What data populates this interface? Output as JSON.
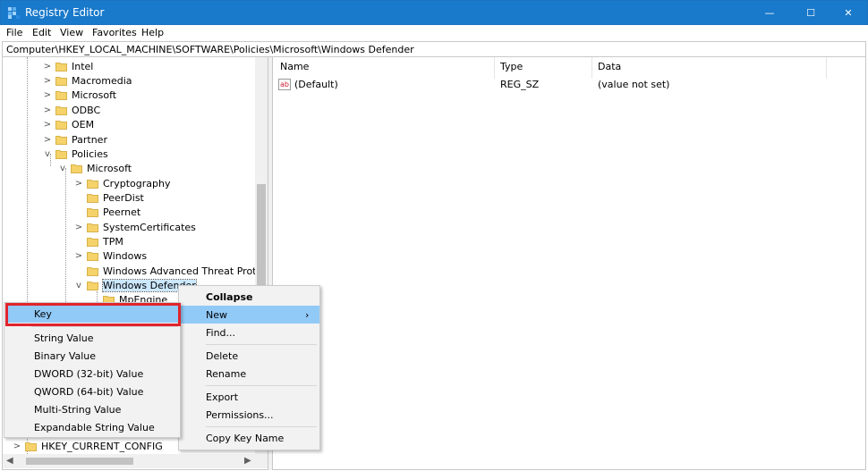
{
  "window": {
    "title": "Registry Editor",
    "minimize_glyph": "—",
    "maximize_glyph": "☐",
    "close_glyph": "✕"
  },
  "menubar": [
    "File",
    "Edit",
    "View",
    "Favorites",
    "Help"
  ],
  "address": "Computer\\HKEY_LOCAL_MACHINE\\SOFTWARE\\Policies\\Microsoft\\Windows Defender",
  "tree": {
    "items": [
      {
        "label": "Intel",
        "expander": ">"
      },
      {
        "label": "Macromedia",
        "expander": ">"
      },
      {
        "label": "Microsoft",
        "expander": ">"
      },
      {
        "label": "ODBC",
        "expander": ">"
      },
      {
        "label": "OEM",
        "expander": ">"
      },
      {
        "label": "Partner",
        "expander": ">"
      },
      {
        "label": "Policies",
        "expander": "v"
      },
      {
        "label": "Microsoft",
        "expander": "v"
      },
      {
        "label": "Cryptography",
        "expander": ">"
      },
      {
        "label": "PeerDist",
        "expander": ""
      },
      {
        "label": "Peernet",
        "expander": ""
      },
      {
        "label": "SystemCertificates",
        "expander": ">"
      },
      {
        "label": "TPM",
        "expander": ""
      },
      {
        "label": "Windows",
        "expander": ">"
      },
      {
        "label": "Windows Advanced Threat Protecti",
        "expander": ""
      },
      {
        "label": "Windows Defender",
        "expander": "v"
      },
      {
        "label": "MpEngine",
        "expander": ""
      }
    ],
    "bottom_item": {
      "label": "HKEY_CURRENT_CONFIG",
      "expander": ">"
    }
  },
  "list": {
    "columns": [
      "Name",
      "Type",
      "Data"
    ],
    "rows": [
      {
        "icon": "ab",
        "name": "(Default)",
        "type": "REG_SZ",
        "data": "(value not set)"
      }
    ]
  },
  "context_menu": {
    "collapse": "Collapse",
    "new": "New",
    "find": "Find...",
    "delete": "Delete",
    "rename": "Rename",
    "export": "Export",
    "permissions": "Permissions...",
    "copy_key_name": "Copy Key Name",
    "submenu_arrow": "›"
  },
  "new_submenu": {
    "key": "Key",
    "items": [
      "String Value",
      "Binary Value",
      "DWORD (32-bit) Value",
      "QWORD (64-bit) Value",
      "Multi-String Value",
      "Expandable String Value"
    ]
  },
  "colors": {
    "titlebar": "#1979ca",
    "folder": "#f5d36a",
    "highlight": "#91c9f7",
    "callout": "#e0242c"
  }
}
